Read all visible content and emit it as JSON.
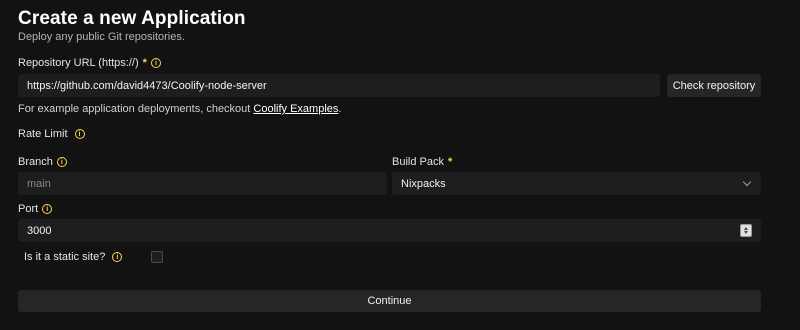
{
  "page": {
    "title": "Create a new Application",
    "subtitle": "Deploy any public Git repositories."
  },
  "repo": {
    "label": "Repository URL (https://)",
    "required": "*",
    "value": "https://github.com/david4473/Coolify-node-server",
    "check_button": "Check repository"
  },
  "hint": {
    "text": "For example application deployments, checkout ",
    "link": "Coolify Examples",
    "suffix": "."
  },
  "rate_limit": {
    "label": "Rate Limit"
  },
  "branch": {
    "label": "Branch",
    "placeholder": "main"
  },
  "build_pack": {
    "label": "Build Pack",
    "required": "*",
    "value": "Nixpacks"
  },
  "port": {
    "label": "Port",
    "value": "3000"
  },
  "static_site": {
    "label": "Is it a static site?",
    "checked": false
  },
  "continue_button": "Continue",
  "colors": {
    "background": "#121212",
    "input_bg": "#1e1e1e",
    "accent": "#fcd34d"
  },
  "icons": [
    "info-icon",
    "chevron-down-icon",
    "stepper-icon"
  ]
}
